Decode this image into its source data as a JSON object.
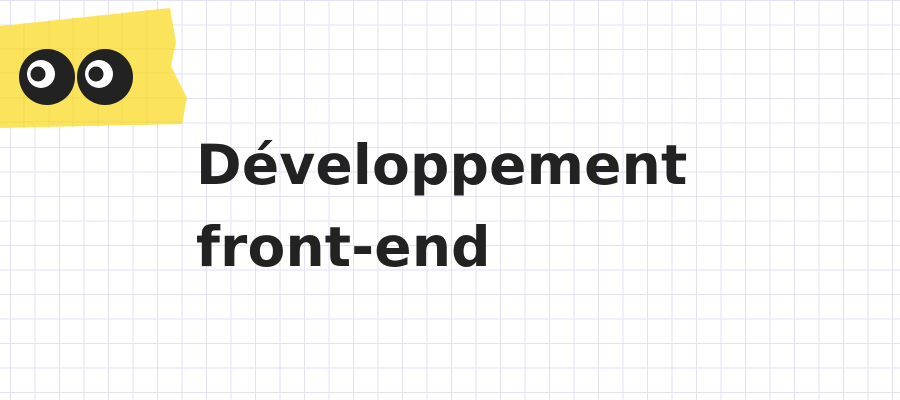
{
  "colors": {
    "text": "#222222",
    "tape": "#fbe45c",
    "grid": "#e2e2f4",
    "eye_white": "#ffffff",
    "eye_dark": "#222222"
  },
  "decoration": {
    "tape_icon": "yellow-tape",
    "eyes_icon": "googly-eyes-icon"
  },
  "heading": {
    "line1": "Développement",
    "line2": "front-end"
  }
}
